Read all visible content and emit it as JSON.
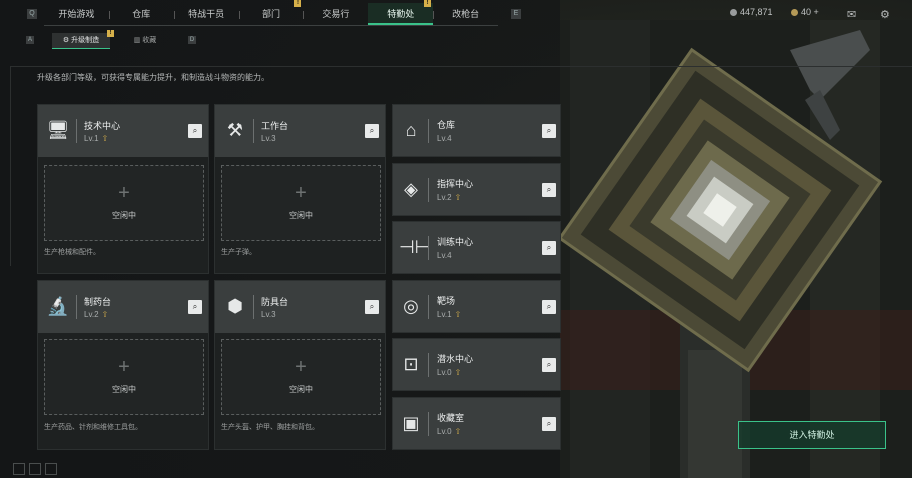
{
  "topbar": {
    "tabs": [
      {
        "label": "开始游戏",
        "alert": false
      },
      {
        "label": "仓库",
        "alert": false
      },
      {
        "label": "特战干员",
        "alert": false
      },
      {
        "label": "部门",
        "alert": true,
        "alert_text": "!"
      },
      {
        "label": "交易行",
        "alert": false
      },
      {
        "label": "特勤处",
        "alert": true,
        "alert_text": "!",
        "active": true
      },
      {
        "label": "改枪台",
        "alert": false
      }
    ],
    "currency": [
      {
        "value": "447,871",
        "icon": "silver-coin-icon"
      },
      {
        "value": "40 +",
        "icon": "gold-coin-icon"
      }
    ],
    "icons": [
      "mail-icon",
      "settings-gear-icon"
    ],
    "nav_left": "Q",
    "nav_right": "E"
  },
  "subtabs": {
    "nav_left": "A",
    "nav_right": "D",
    "items": [
      {
        "label": "升级制造",
        "active": true,
        "alert": true,
        "alert_text": "!"
      },
      {
        "label": "收藏",
        "active": false
      }
    ]
  },
  "description": "升级各部门等级，可获得专属能力提升，和制造战斗物资的能力。",
  "large_cards": [
    {
      "name": "技术中心",
      "level": "Lv.1",
      "icon": "monitor-icon",
      "slot_text": "空闲中",
      "footer": "生产枪械和配件。"
    },
    {
      "name": "工作台",
      "level": "Lv.3",
      "icon": "tools-icon",
      "slot_text": "空闲中",
      "footer": "生产子弹。"
    },
    {
      "name": "制药台",
      "level": "Lv.2",
      "icon": "microscope-icon",
      "slot_text": "空闲中",
      "footer": "生产药品、针剂和维修工具包。"
    },
    {
      "name": "防具台",
      "level": "Lv.3",
      "icon": "armor-icon",
      "slot_text": "空闲中",
      "footer": "生产头盔、护甲、胸挂和背包。"
    }
  ],
  "small_cards": [
    {
      "name": "仓库",
      "level": "Lv.4",
      "icon": "warehouse-icon"
    },
    {
      "name": "指挥中心",
      "level": "Lv.2",
      "icon": "command-diamond-icon"
    },
    {
      "name": "训练中心",
      "level": "Lv.4",
      "icon": "dumbbell-icon"
    },
    {
      "name": "靶场",
      "level": "Lv.1",
      "icon": "target-icon"
    },
    {
      "name": "潜水中心",
      "level": "Lv.0",
      "icon": "diving-mask-icon"
    },
    {
      "name": "收藏室",
      "level": "Lv.0",
      "icon": "collection-case-icon"
    }
  ],
  "cta_label": "进入特勤处",
  "search_icon": "search-icon",
  "upgrade_arrow": "⇧",
  "plus_glyph": "+"
}
